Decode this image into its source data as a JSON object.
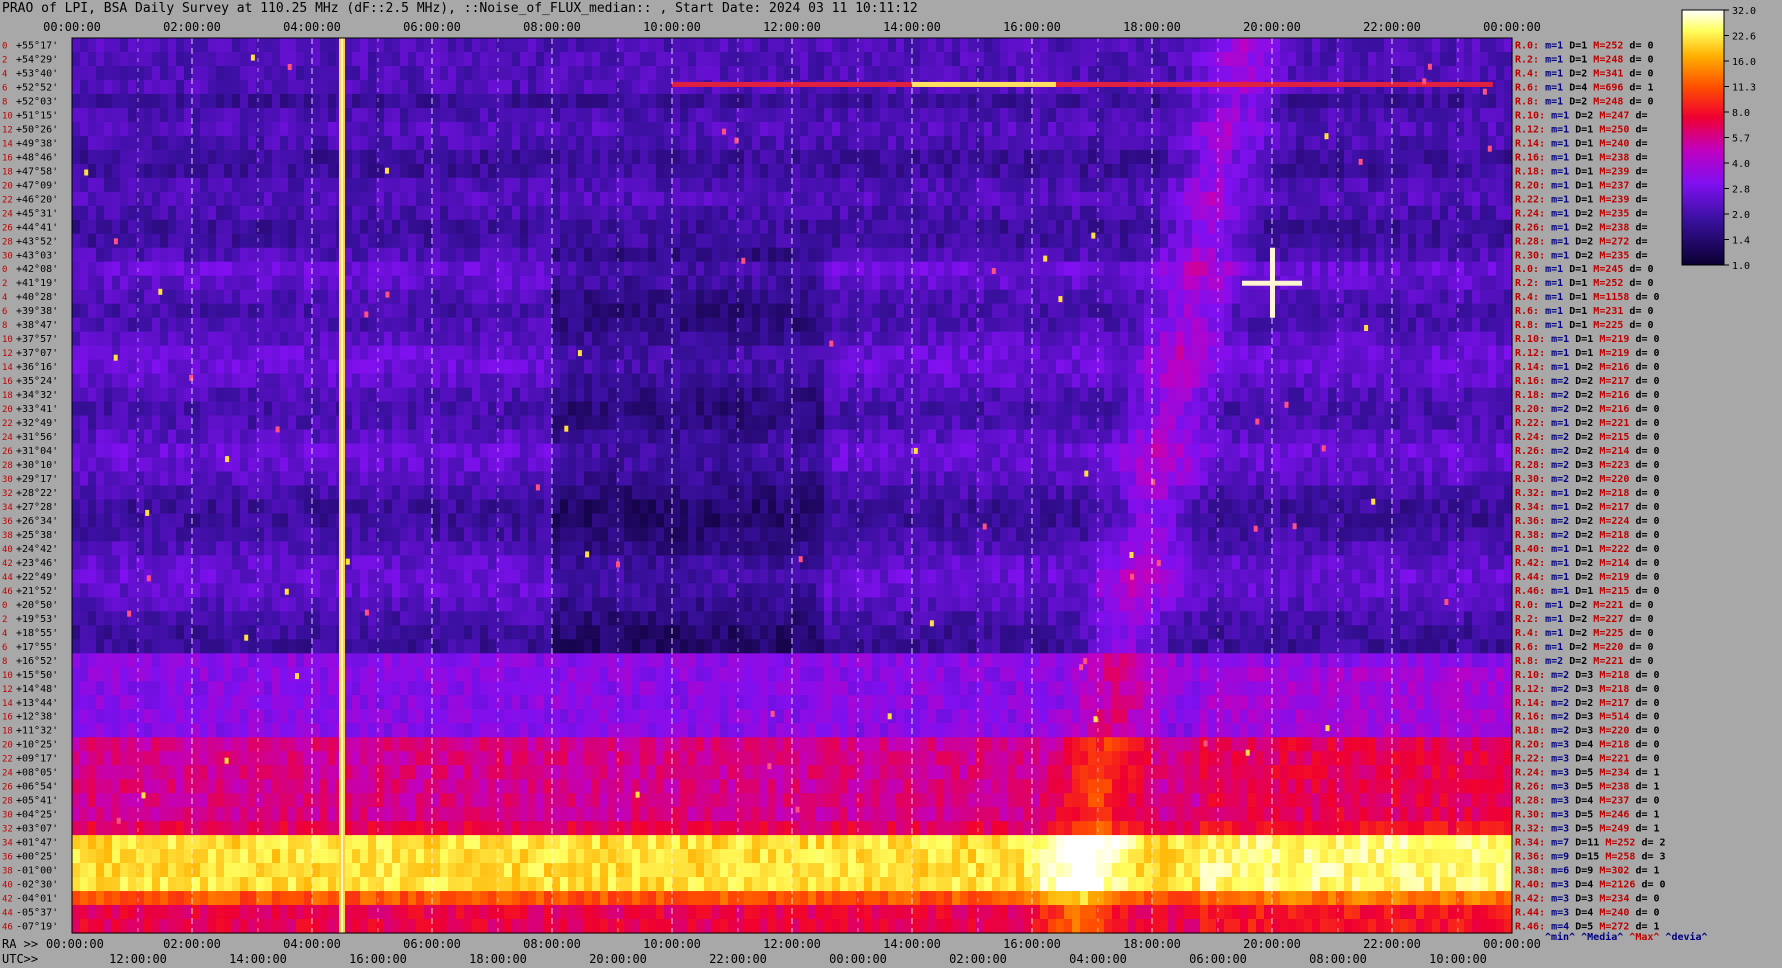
{
  "title": "PRAO of LPI, BSA Daily Survey at 110.25 MHz (dF::2.5 MHz), ::Noise_of_FLUX_median:: , Start Date: 2024 03 11 10:11:12",
  "colors": {
    "background": "#a8a8a8",
    "label_red": "#c00000",
    "label_navy": "#000080",
    "label_black": "#000000"
  },
  "chart_data": {
    "type": "heatmap",
    "x_axis_top_ticks": [
      "00:00:00",
      "02:00:00",
      "04:00:00",
      "06:00:00",
      "08:00:00",
      "10:00:00",
      "12:00:00",
      "14:00:00",
      "16:00:00",
      "18:00:00",
      "20:00:00",
      "22:00:00",
      "00:00:00"
    ],
    "x_axis_bottom": {
      "ra_label": "RA >>",
      "utc_label": "UTC>>",
      "ra_ticks": [
        "00:00:00",
        "02:00:00",
        "04:00:00",
        "06:00:00",
        "08:00:00",
        "10:00:00",
        "12:00:00",
        "14:00:00",
        "16:00:00",
        "18:00:00",
        "20:00:00",
        "22:00:00",
        "00:00:00"
      ],
      "utc_ticks": [
        "12:00:00",
        "14:00:00",
        "16:00:00",
        "18:00:00",
        "20:00:00",
        "22:00:00",
        "00:00:00",
        "02:00:00",
        "04:00:00",
        "06:00:00",
        "08:00:00",
        "10:00:00"
      ]
    },
    "y_ticks": [
      "+55°17'",
      "+54°29'",
      "+53°40'",
      "+52°52'",
      "+52°03'",
      "+51°15'",
      "+50°26'",
      "+49°38'",
      "+48°46'",
      "+47°58'",
      "+47°09'",
      "+46°20'",
      "+45°31'",
      "+44°41'",
      "+43°52'",
      "+43°03'",
      "+42°08'",
      "+41°19'",
      "+40°28'",
      "+39°38'",
      "+38°47'",
      "+37°57'",
      "+37°07'",
      "+36°16'",
      "+35°24'",
      "+34°32'",
      "+33°41'",
      "+32°49'",
      "+31°56'",
      "+31°04'",
      "+30°10'",
      "+29°17'",
      "+28°22'",
      "+27°28'",
      "+26°34'",
      "+25°38'",
      "+24°42'",
      "+23°46'",
      "+22°49'",
      "+21°52'",
      "+20°50'",
      "+19°53'",
      "+18°55'",
      "+17°55'",
      "+16°52'",
      "+15°50'",
      "+14°48'",
      "+13°44'",
      "+12°38'",
      "+11°32'",
      "+10°25'",
      "+09°17'",
      "+08°05'",
      "+06°54'",
      "+05°41'",
      "+04°25'",
      "+03°07'",
      "+01°47'",
      "+00°25'",
      "-01°00'",
      "-02°30'",
      "-04°01'",
      "-05°37'",
      "-07°19'"
    ],
    "row_index_labels": [
      "0",
      "2",
      "4",
      "6",
      "8",
      "10",
      "12",
      "14",
      "16",
      "18",
      "20",
      "22",
      "24",
      "26",
      "28",
      "30",
      "0",
      "2",
      "4",
      "6",
      "8",
      "10",
      "12",
      "14",
      "16",
      "18",
      "20",
      "22",
      "24",
      "26",
      "28",
      "30",
      "32",
      "34",
      "36",
      "38",
      "40",
      "42",
      "44",
      "46",
      "0",
      "2",
      "4",
      "6",
      "8",
      "10",
      "12",
      "14",
      "16",
      "18",
      "20",
      "22",
      "24",
      "26",
      "28",
      "30",
      "32",
      "34",
      "36",
      "38",
      "40",
      "42",
      "44",
      "46"
    ],
    "colorbar": {
      "ticks": [
        "32.0",
        "22.6",
        "16.0",
        "11.3",
        "8.0",
        "5.7",
        "4.0",
        "2.8",
        "2.0",
        "1.4",
        "1.0"
      ],
      "scale": "log"
    },
    "right_stats": [
      {
        "r": "R.0:",
        "m": "m=1",
        "d": "D=1",
        "mx": "M=252",
        "dv": "d= 0"
      },
      {
        "r": "R.2:",
        "m": "m=1",
        "d": "D=1",
        "mx": "M=248",
        "dv": "d= 0"
      },
      {
        "r": "R.4:",
        "m": "m=1",
        "d": "D=2",
        "mx": "M=341",
        "dv": "d= 0"
      },
      {
        "r": "R.6:",
        "m": "m=1",
        "d": "D=4",
        "mx": "M=696",
        "dv": "d= 1"
      },
      {
        "r": "R.8:",
        "m": "m=1",
        "d": "D=2",
        "mx": "M=248",
        "dv": "d= 0"
      },
      {
        "r": "R.10:",
        "m": "m=1",
        "d": "D=2",
        "mx": "M=247",
        "dv": "d="
      },
      {
        "r": "R.12:",
        "m": "m=1",
        "d": "D=1",
        "mx": "M=250",
        "dv": "d="
      },
      {
        "r": "R.14:",
        "m": "m=1",
        "d": "D=1",
        "mx": "M=240",
        "dv": "d="
      },
      {
        "r": "R.16:",
        "m": "m=1",
        "d": "D=1",
        "mx": "M=238",
        "dv": "d="
      },
      {
        "r": "R.18:",
        "m": "m=1",
        "d": "D=1",
        "mx": "M=239",
        "dv": "d="
      },
      {
        "r": "R.20:",
        "m": "m=1",
        "d": "D=1",
        "mx": "M=237",
        "dv": "d="
      },
      {
        "r": "R.22:",
        "m": "m=1",
        "d": "D=1",
        "mx": "M=239",
        "dv": "d="
      },
      {
        "r": "R.24:",
        "m": "m=1",
        "d": "D=2",
        "mx": "M=235",
        "dv": "d="
      },
      {
        "r": "R.26:",
        "m": "m=1",
        "d": "D=2",
        "mx": "M=238",
        "dv": "d="
      },
      {
        "r": "R.28:",
        "m": "m=1",
        "d": "D=2",
        "mx": "M=272",
        "dv": "d="
      },
      {
        "r": "R.30:",
        "m": "m=1",
        "d": "D=2",
        "mx": "M=235",
        "dv": "d="
      },
      {
        "r": "R.0:",
        "m": "m=1",
        "d": "D=1",
        "mx": "M=245",
        "dv": "d= 0"
      },
      {
        "r": "R.2:",
        "m": "m=1",
        "d": "D=1",
        "mx": "M=252",
        "dv": "d= 0"
      },
      {
        "r": "R.4:",
        "m": "m=1",
        "d": "D=1",
        "mx": "M=1158",
        "dv": "d= 0"
      },
      {
        "r": "R.6:",
        "m": "m=1",
        "d": "D=1",
        "mx": "M=231",
        "dv": "d= 0"
      },
      {
        "r": "R.8:",
        "m": "m=1",
        "d": "D=1",
        "mx": "M=225",
        "dv": "d= 0"
      },
      {
        "r": "R.10:",
        "m": "m=1",
        "d": "D=1",
        "mx": "M=219",
        "dv": "d= 0"
      },
      {
        "r": "R.12:",
        "m": "m=1",
        "d": "D=1",
        "mx": "M=219",
        "dv": "d= 0"
      },
      {
        "r": "R.14:",
        "m": "m=1",
        "d": "D=2",
        "mx": "M=216",
        "dv": "d= 0"
      },
      {
        "r": "R.16:",
        "m": "m=2",
        "d": "D=2",
        "mx": "M=217",
        "dv": "d= 0"
      },
      {
        "r": "R.18:",
        "m": "m=2",
        "d": "D=2",
        "mx": "M=216",
        "dv": "d= 0"
      },
      {
        "r": "R.20:",
        "m": "m=2",
        "d": "D=2",
        "mx": "M=216",
        "dv": "d= 0"
      },
      {
        "r": "R.22:",
        "m": "m=1",
        "d": "D=2",
        "mx": "M=221",
        "dv": "d= 0"
      },
      {
        "r": "R.24:",
        "m": "m=2",
        "d": "D=2",
        "mx": "M=215",
        "dv": "d= 0"
      },
      {
        "r": "R.26:",
        "m": "m=2",
        "d": "D=2",
        "mx": "M=214",
        "dv": "d= 0"
      },
      {
        "r": "R.28:",
        "m": "m=2",
        "d": "D=3",
        "mx": "M=223",
        "dv": "d= 0"
      },
      {
        "r": "R.30:",
        "m": "m=2",
        "d": "D=2",
        "mx": "M=220",
        "dv": "d= 0"
      },
      {
        "r": "R.32:",
        "m": "m=1",
        "d": "D=2",
        "mx": "M=218",
        "dv": "d= 0"
      },
      {
        "r": "R.34:",
        "m": "m=1",
        "d": "D=2",
        "mx": "M=217",
        "dv": "d= 0"
      },
      {
        "r": "R.36:",
        "m": "m=2",
        "d": "D=2",
        "mx": "M=224",
        "dv": "d= 0"
      },
      {
        "r": "R.38:",
        "m": "m=2",
        "d": "D=2",
        "mx": "M=218",
        "dv": "d= 0"
      },
      {
        "r": "R.40:",
        "m": "m=1",
        "d": "D=1",
        "mx": "M=222",
        "dv": "d= 0"
      },
      {
        "r": "R.42:",
        "m": "m=1",
        "d": "D=2",
        "mx": "M=214",
        "dv": "d= 0"
      },
      {
        "r": "R.44:",
        "m": "m=1",
        "d": "D=2",
        "mx": "M=219",
        "dv": "d= 0"
      },
      {
        "r": "R.46:",
        "m": "m=1",
        "d": "D=1",
        "mx": "M=215",
        "dv": "d= 0"
      },
      {
        "r": "R.0:",
        "m": "m=1",
        "d": "D=2",
        "mx": "M=221",
        "dv": "d= 0"
      },
      {
        "r": "R.2:",
        "m": "m=1",
        "d": "D=2",
        "mx": "M=227",
        "dv": "d= 0"
      },
      {
        "r": "R.4:",
        "m": "m=1",
        "d": "D=2",
        "mx": "M=225",
        "dv": "d= 0"
      },
      {
        "r": "R.6:",
        "m": "m=1",
        "d": "D=2",
        "mx": "M=220",
        "dv": "d= 0"
      },
      {
        "r": "R.8:",
        "m": "m=2",
        "d": "D=2",
        "mx": "M=221",
        "dv": "d= 0"
      },
      {
        "r": "R.10:",
        "m": "m=2",
        "d": "D=3",
        "mx": "M=218",
        "dv": "d= 0"
      },
      {
        "r": "R.12:",
        "m": "m=2",
        "d": "D=3",
        "mx": "M=218",
        "dv": "d= 0"
      },
      {
        "r": "R.14:",
        "m": "m=2",
        "d": "D=2",
        "mx": "M=217",
        "dv": "d= 0"
      },
      {
        "r": "R.16:",
        "m": "m=2",
        "d": "D=3",
        "mx": "M=514",
        "dv": "d= 0"
      },
      {
        "r": "R.18:",
        "m": "m=2",
        "d": "D=3",
        "mx": "M=220",
        "dv": "d= 0"
      },
      {
        "r": "R.20:",
        "m": "m=3",
        "d": "D=4",
        "mx": "M=218",
        "dv": "d= 0"
      },
      {
        "r": "R.22:",
        "m": "m=3",
        "d": "D=4",
        "mx": "M=221",
        "dv": "d= 0"
      },
      {
        "r": "R.24:",
        "m": "m=3",
        "d": "D=5",
        "mx": "M=234",
        "dv": "d= 1"
      },
      {
        "r": "R.26:",
        "m": "m=3",
        "d": "D=5",
        "mx": "M=238",
        "dv": "d= 1"
      },
      {
        "r": "R.28:",
        "m": "m=3",
        "d": "D=4",
        "mx": "M=237",
        "dv": "d= 0"
      },
      {
        "r": "R.30:",
        "m": "m=3",
        "d": "D=5",
        "mx": "M=246",
        "dv": "d= 1"
      },
      {
        "r": "R.32:",
        "m": "m=3",
        "d": "D=5",
        "mx": "M=249",
        "dv": "d= 1"
      },
      {
        "r": "R.34:",
        "m": "m=7",
        "d": "D=11",
        "mx": "M=252",
        "dv": "d= 2"
      },
      {
        "r": "R.36:",
        "m": "m=9",
        "d": "D=15",
        "mx": "M=258",
        "dv": "d= 3"
      },
      {
        "r": "R.38:",
        "m": "m=6",
        "d": "D=9",
        "mx": "M=302",
        "dv": "d= 1"
      },
      {
        "r": "R.40:",
        "m": "m=3",
        "d": "D=4",
        "mx": "M=2126",
        "dv": "d= 0"
      },
      {
        "r": "R.42:",
        "m": "m=3",
        "d": "D=3",
        "mx": "M=234",
        "dv": "d= 0"
      },
      {
        "r": "R.44:",
        "m": "m=3",
        "d": "D=4",
        "mx": "M=240",
        "dv": "d= 0"
      },
      {
        "r": "R.46:",
        "m": "m=4",
        "d": "D=5",
        "mx": "M=272",
        "dv": "d= 1"
      }
    ],
    "legend_footer": [
      {
        "text": "^min^",
        "color": "#000080"
      },
      {
        "text": "^Media^",
        "color": "#000080"
      },
      {
        "text": "^Max^",
        "color": "#c00000"
      },
      {
        "text": "^devia^",
        "color": "#000080"
      }
    ]
  }
}
